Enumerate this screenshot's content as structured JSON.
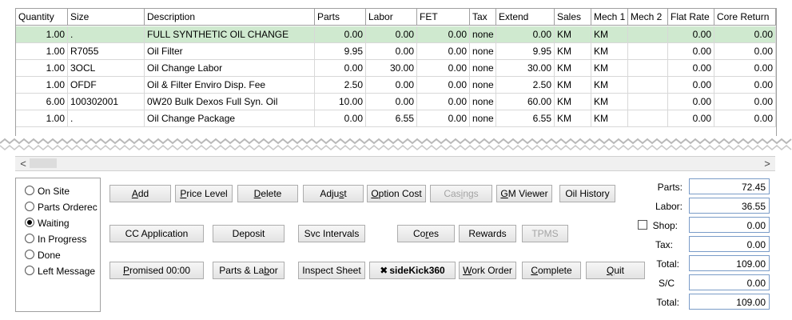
{
  "grid": {
    "columns": [
      "Quantity",
      "Size",
      "Description",
      "Parts",
      "Labor",
      "FET",
      "Tax",
      "Extend",
      "Sales",
      "Mech 1",
      "Mech 2",
      "Flat Rate",
      "Core Return"
    ],
    "rows": [
      [
        "1.00",
        ".",
        "FULL SYNTHETIC OIL CHANGE",
        "0.00",
        "0.00",
        "0.00",
        "none",
        "0.00",
        "KM",
        "KM",
        "",
        "0.00",
        "0.00"
      ],
      [
        "1.00",
        "R7055",
        "Oil Filter",
        "9.95",
        "0.00",
        "0.00",
        "none",
        "9.95",
        "KM",
        "KM",
        "",
        "0.00",
        "0.00"
      ],
      [
        "1.00",
        "3OCL",
        "Oil Change Labor",
        "0.00",
        "30.00",
        "0.00",
        "none",
        "30.00",
        "KM",
        "KM",
        "",
        "0.00",
        "0.00"
      ],
      [
        "1.00",
        "OFDF",
        "Oil & Filter Enviro Disp. Fee",
        "2.50",
        "0.00",
        "0.00",
        "none",
        "2.50",
        "KM",
        "KM",
        "",
        "0.00",
        "0.00"
      ],
      [
        "6.00",
        "100302001",
        "0W20 Bulk Dexos Full Syn. Oil",
        "10.00",
        "0.00",
        "0.00",
        "none",
        "60.00",
        "KM",
        "KM",
        "",
        "0.00",
        "0.00"
      ],
      [
        "1.00",
        ".",
        "Oil Change Package",
        "0.00",
        "6.55",
        "0.00",
        "none",
        "6.55",
        "KM",
        "KM",
        "",
        "0.00",
        "0.00"
      ]
    ]
  },
  "scrollbar": {
    "left_arrow": "<",
    "right_arrow": ">"
  },
  "status": {
    "options": [
      "On Site",
      "Parts Orderec",
      "Waiting",
      "In Progress",
      "Done",
      "Left Message"
    ],
    "selected": "Waiting"
  },
  "buttons": {
    "add": {
      "pre": "",
      "u": "A",
      "post": "dd"
    },
    "price_level": {
      "pre": "",
      "u": "P",
      "post": "rice Level"
    },
    "delete": {
      "pre": "",
      "u": "D",
      "post": "elete"
    },
    "adjust": {
      "pre": "Adju",
      "u": "s",
      "post": "t"
    },
    "option_cost": {
      "pre": "",
      "u": "O",
      "post": "ption Cost"
    },
    "casings": {
      "pre": "Cas",
      "u": "i",
      "post": "ngs"
    },
    "gm_viewer": {
      "pre": "",
      "u": "G",
      "post": "M Viewer"
    },
    "oil_history": {
      "pre": "Oil History",
      "u": "",
      "post": ""
    },
    "cc_application": {
      "pre": "CC Application",
      "u": "",
      "post": ""
    },
    "deposit": {
      "pre": "Deposit",
      "u": "",
      "post": ""
    },
    "svc_intervals": {
      "pre": "Svc Intervals",
      "u": "",
      "post": ""
    },
    "cores": {
      "pre": "Co",
      "u": "r",
      "post": "es"
    },
    "rewards": {
      "pre": "Rewards",
      "u": "",
      "post": ""
    },
    "tpms": {
      "pre": "TPMS",
      "u": "",
      "post": ""
    },
    "promised": {
      "pre": "",
      "u": "P",
      "post": "romised  00:00"
    },
    "parts_labor": {
      "pre": "Parts & La",
      "u": "b",
      "post": "or"
    },
    "inspect_sheet": {
      "pre": "Inspect Sheet",
      "u": "",
      "post": ""
    },
    "sidekick": {
      "text": "sideKick360"
    },
    "work_order": {
      "pre": "",
      "u": "W",
      "post": "ork Order"
    },
    "complete": {
      "pre": "",
      "u": "C",
      "post": "omplete"
    },
    "quit": {
      "pre": "",
      "u": "Q",
      "post": "uit"
    }
  },
  "totals": {
    "parts_label": "Parts:",
    "parts": "72.45",
    "labor_label": "Labor:",
    "labor": "36.55",
    "shop_label": "Shop:",
    "shop": "0.00",
    "tax_label": "Tax:",
    "tax": "0.00",
    "total_label": "Total:",
    "total": "109.00",
    "sc_label": "S/C",
    "sc": "0.00",
    "grand_total_label": "Total:",
    "grand_total": "109.00"
  },
  "colors": {
    "selected_row": "#cfe9cf",
    "field_border": "#7a9cc8"
  }
}
